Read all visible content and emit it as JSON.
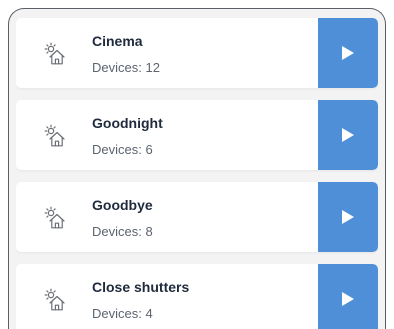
{
  "scenes": [
    {
      "name": "Cinema",
      "devices": "Devices: 12",
      "icon": "house-sun-icon",
      "action_icon": "play-icon"
    },
    {
      "name": "Goodnight",
      "devices": "Devices: 6",
      "icon": "house-sun-icon",
      "action_icon": "play-icon"
    },
    {
      "name": "Goodbye",
      "devices": "Devices: 8",
      "icon": "house-sun-icon",
      "action_icon": "play-icon"
    },
    {
      "name": "Close shutters",
      "devices": "Devices: 4",
      "icon": "house-sun-icon",
      "action_icon": "play-icon"
    }
  ],
  "colors": {
    "accent": "#4f8fd8",
    "card_background": "#ffffff",
    "list_background": "#f3f3f4",
    "title_text": "#1f2b3d",
    "secondary_text": "#5c6470",
    "frame_border": "#5a5f66"
  }
}
